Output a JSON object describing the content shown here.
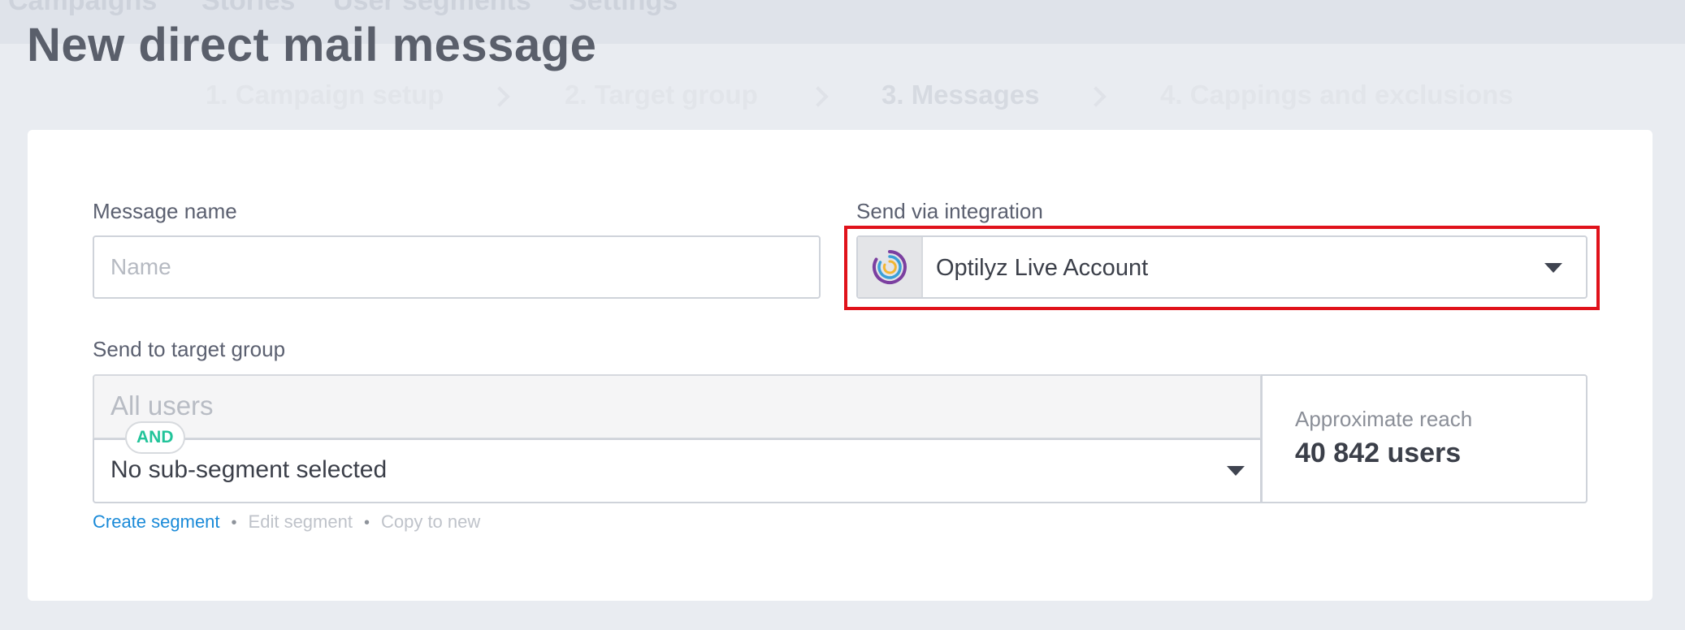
{
  "topnav": {
    "items": [
      "Campaigns",
      "Stories",
      "User segments",
      "Settings"
    ]
  },
  "page": {
    "title": "New direct mail message"
  },
  "steps": [
    {
      "label": "1. Campaign setup",
      "active": false
    },
    {
      "label": "2. Target group",
      "active": false
    },
    {
      "label": "3. Messages",
      "active": true
    },
    {
      "label": "4. Cappings and exclusions",
      "active": false
    }
  ],
  "form": {
    "message_name": {
      "label": "Message name",
      "placeholder": "Name",
      "value": ""
    },
    "integration": {
      "label": "Send via integration",
      "value": "Optilyz Live Account",
      "icon": "optilyz-logo-icon",
      "highlight_color": "#e0121b"
    },
    "target_group": {
      "label": "Send to target group",
      "base_segment": "All users",
      "operator": "AND",
      "sub_segment": "No sub-segment selected",
      "reach_label": "Approximate reach",
      "reach_value": "40 842 users"
    },
    "links": {
      "create": "Create segment",
      "edit": "Edit segment",
      "copy": "Copy to new"
    }
  },
  "colors": {
    "accent_link": "#1a8ad8",
    "and_badge": "#22c49a"
  }
}
